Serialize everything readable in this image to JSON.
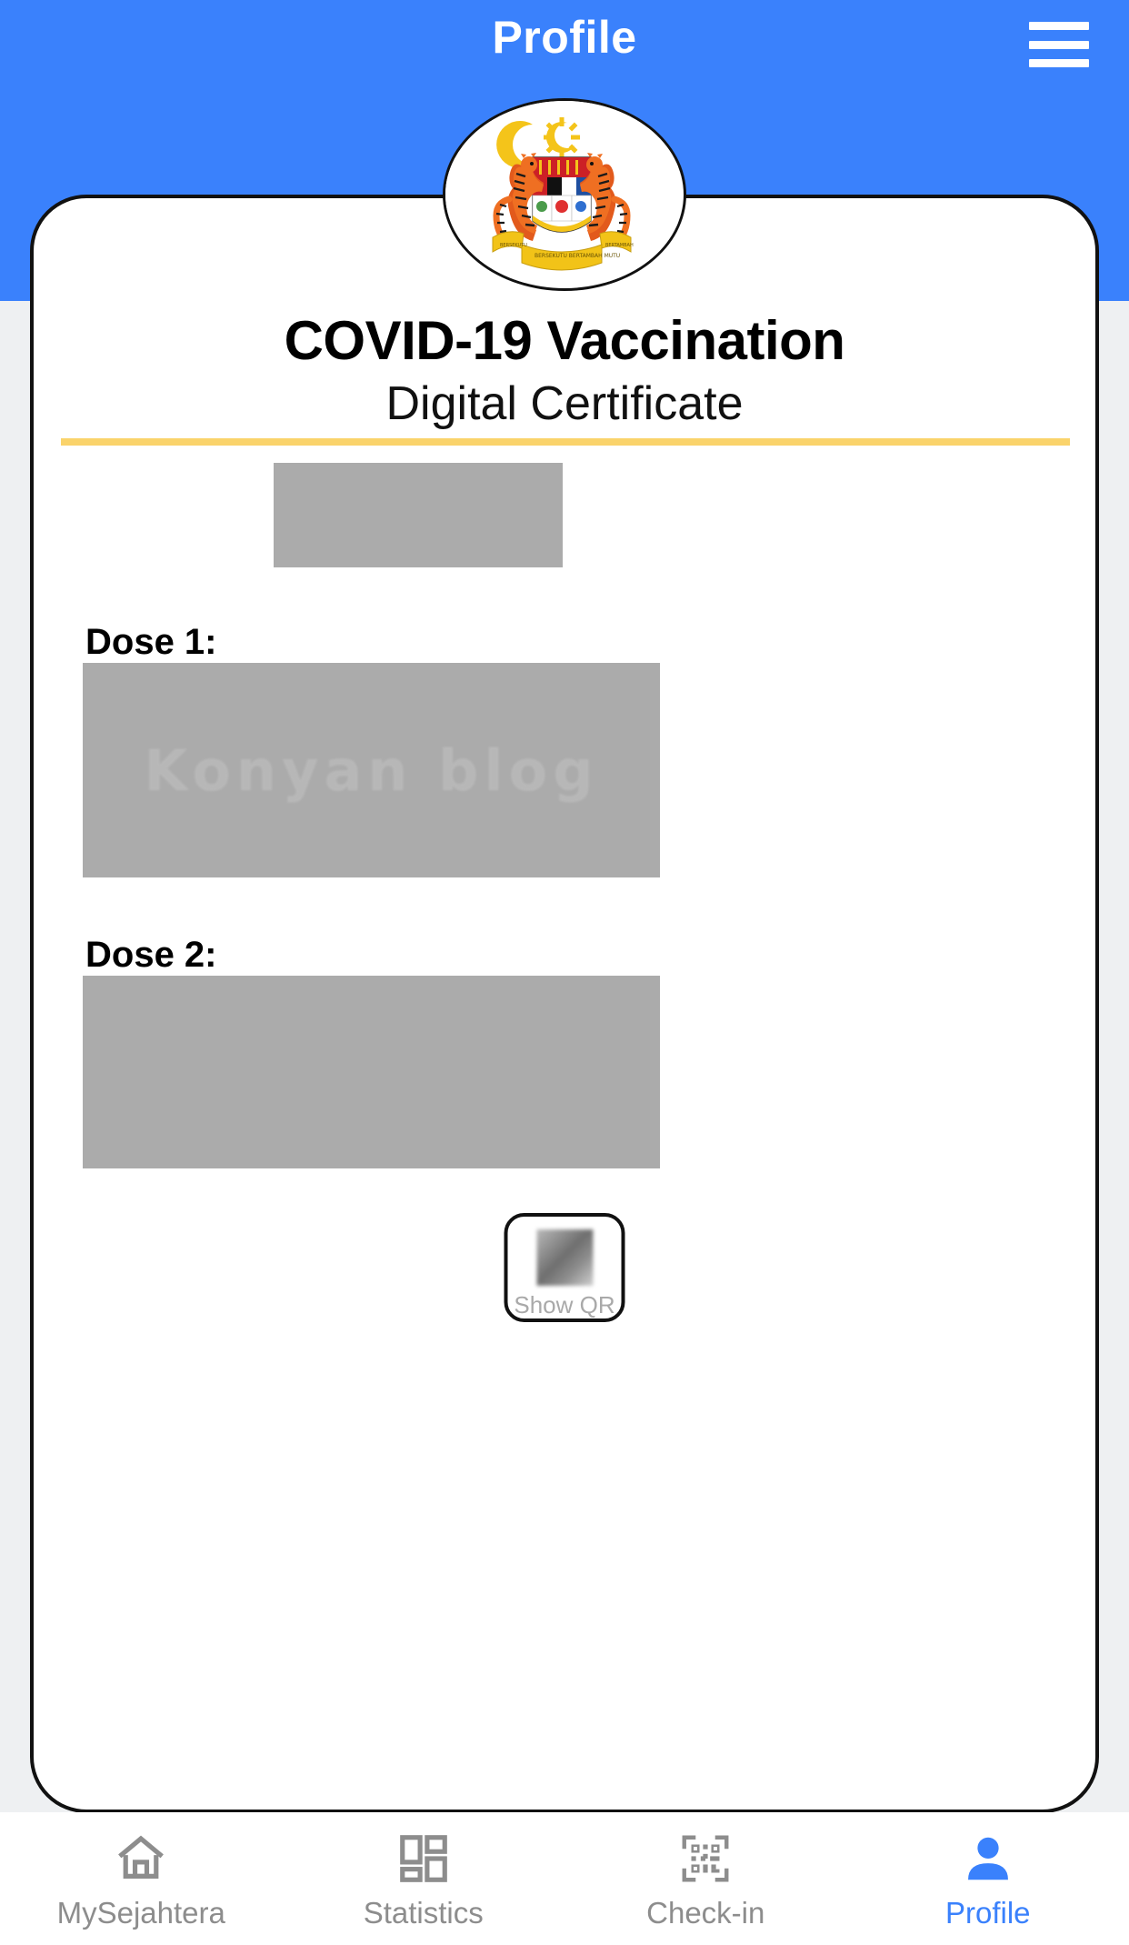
{
  "header": {
    "title": "Profile",
    "menu_icon": "hamburger-menu-icon",
    "background_color": "#3A81FC"
  },
  "certificate": {
    "emblem_icon": "malaysia-coat-of-arms",
    "title": "COVID-19 Vaccination",
    "subtitle": "Digital Certificate",
    "divider_color": "#FAD36B",
    "redacted_color": "#ABABAB",
    "name_field": {
      "label": "",
      "value": "",
      "redacted": true
    },
    "doses": [
      {
        "label": "Dose 1:",
        "value": "",
        "redacted": true,
        "watermark": "Konyan blog"
      },
      {
        "label": "Dose 2:",
        "value": "",
        "redacted": true,
        "watermark": ""
      }
    ],
    "qr_button": {
      "label": "Show QR",
      "icon": "qr-code-icon"
    }
  },
  "bottom_nav": {
    "active_color": "#3A81FC",
    "inactive_color": "#8D8D8D",
    "items": [
      {
        "label": "MySejahtera",
        "icon": "home-icon",
        "active": false
      },
      {
        "label": "Statistics",
        "icon": "grid-dashboard-icon",
        "active": false
      },
      {
        "label": "Check-in",
        "icon": "qr-scan-icon",
        "active": false
      },
      {
        "label": "Profile",
        "icon": "person-icon",
        "active": true
      }
    ]
  }
}
